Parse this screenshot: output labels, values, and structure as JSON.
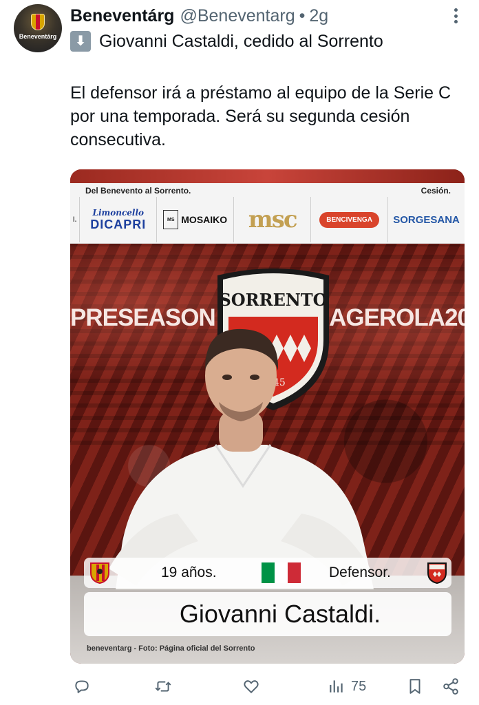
{
  "author": {
    "name": "Beneventárg",
    "handle": "@Beneventarg",
    "separator": "•",
    "time": "2g",
    "avatar_label": "Beneventárg",
    "avatar_icon": "club-crest-icon"
  },
  "tweet": {
    "headline_icon": "down-arrow-emoji-icon",
    "headline": "Giovanni Castaldi, cedido al Sorrento",
    "body": "El defensor irá a préstamo al equipo de la Serie C por una temporada. Será su segunda cesión consecutiva."
  },
  "media": {
    "board_left": "Del Benevento al Sorrento.",
    "board_right": "Cesión.",
    "sponsors": [
      "Limoncello",
      "DICAPRI",
      "MOSAIKO",
      "msc",
      "BENCIVENGA",
      "SORGESANA"
    ],
    "backdrop_left": "PRESEASON",
    "backdrop_right": "AGEROLA20",
    "shield_name": "SORRENTO",
    "shield_year": "1945",
    "age": "19 años.",
    "position": "Defensor.",
    "player_name": "Giovanni Castaldi.",
    "credit": "beneventarg - Foto: Página oficial del Sorrento",
    "flag_colors": [
      "#009246",
      "#ffffff",
      "#ce2b37"
    ]
  },
  "actions": {
    "reply_icon": "reply-icon",
    "retweet_icon": "retweet-icon",
    "like_icon": "like-icon",
    "views_icon": "views-icon",
    "views_count": "75",
    "bookmark_icon": "bookmark-icon",
    "share_icon": "share-icon"
  }
}
